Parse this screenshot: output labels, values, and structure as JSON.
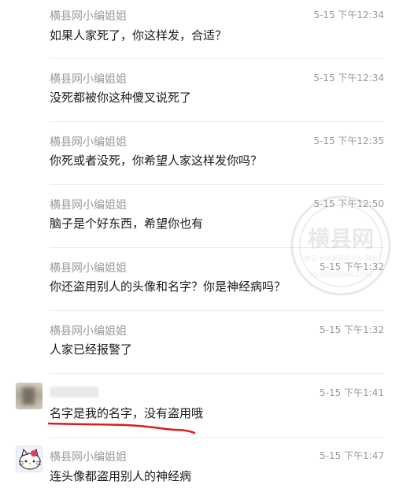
{
  "comments": [
    {
      "author": "横县网小编姐姐",
      "time": "5-15 下午12:34",
      "text": "如果人家死了，你这样发，合适？"
    },
    {
      "author": "横县网小编姐姐",
      "time": "5-15 下午12:34",
      "text": "没死都被你这种傻叉说死了"
    },
    {
      "author": "横县网小编姐姐",
      "time": "5-15 下午12:35",
      "text": "你死或者没死，你希望人家这样发你吗？"
    },
    {
      "author": "横县网小编姐姐",
      "time": "5-15 下午12:50",
      "text": "脑子是个好东西，希望你也有"
    },
    {
      "author": "横县网小编姐姐",
      "time": "5-15 下午1:32",
      "text": "你还盗用别人的头像和名字？你是神经病吗？"
    },
    {
      "author": "横县网小编姐姐",
      "time": "5-15 下午1:32",
      "text": "人家已经报警了"
    },
    {
      "author": "",
      "time": "5-15 下午1:41",
      "text": "名字是我的名字，没有盗用哦"
    },
    {
      "author": "横县网小编姐姐",
      "time": "5-15 下午1:47",
      "text": "连头像都盗用别人的神经病"
    }
  ],
  "watermark": {
    "title": "横县网",
    "subtitle": "横县·中华茉莉花之乡·网站",
    "url": "HENGXIANW.COM"
  },
  "colors": {
    "annotation": "#d81e1e",
    "meta": "#9a9a9a",
    "divider": "#ececec"
  },
  "icons": {
    "avatar_blurred": "blurred-avatar-icon",
    "avatar_kitty": "hello-kitty-avatar-icon"
  }
}
